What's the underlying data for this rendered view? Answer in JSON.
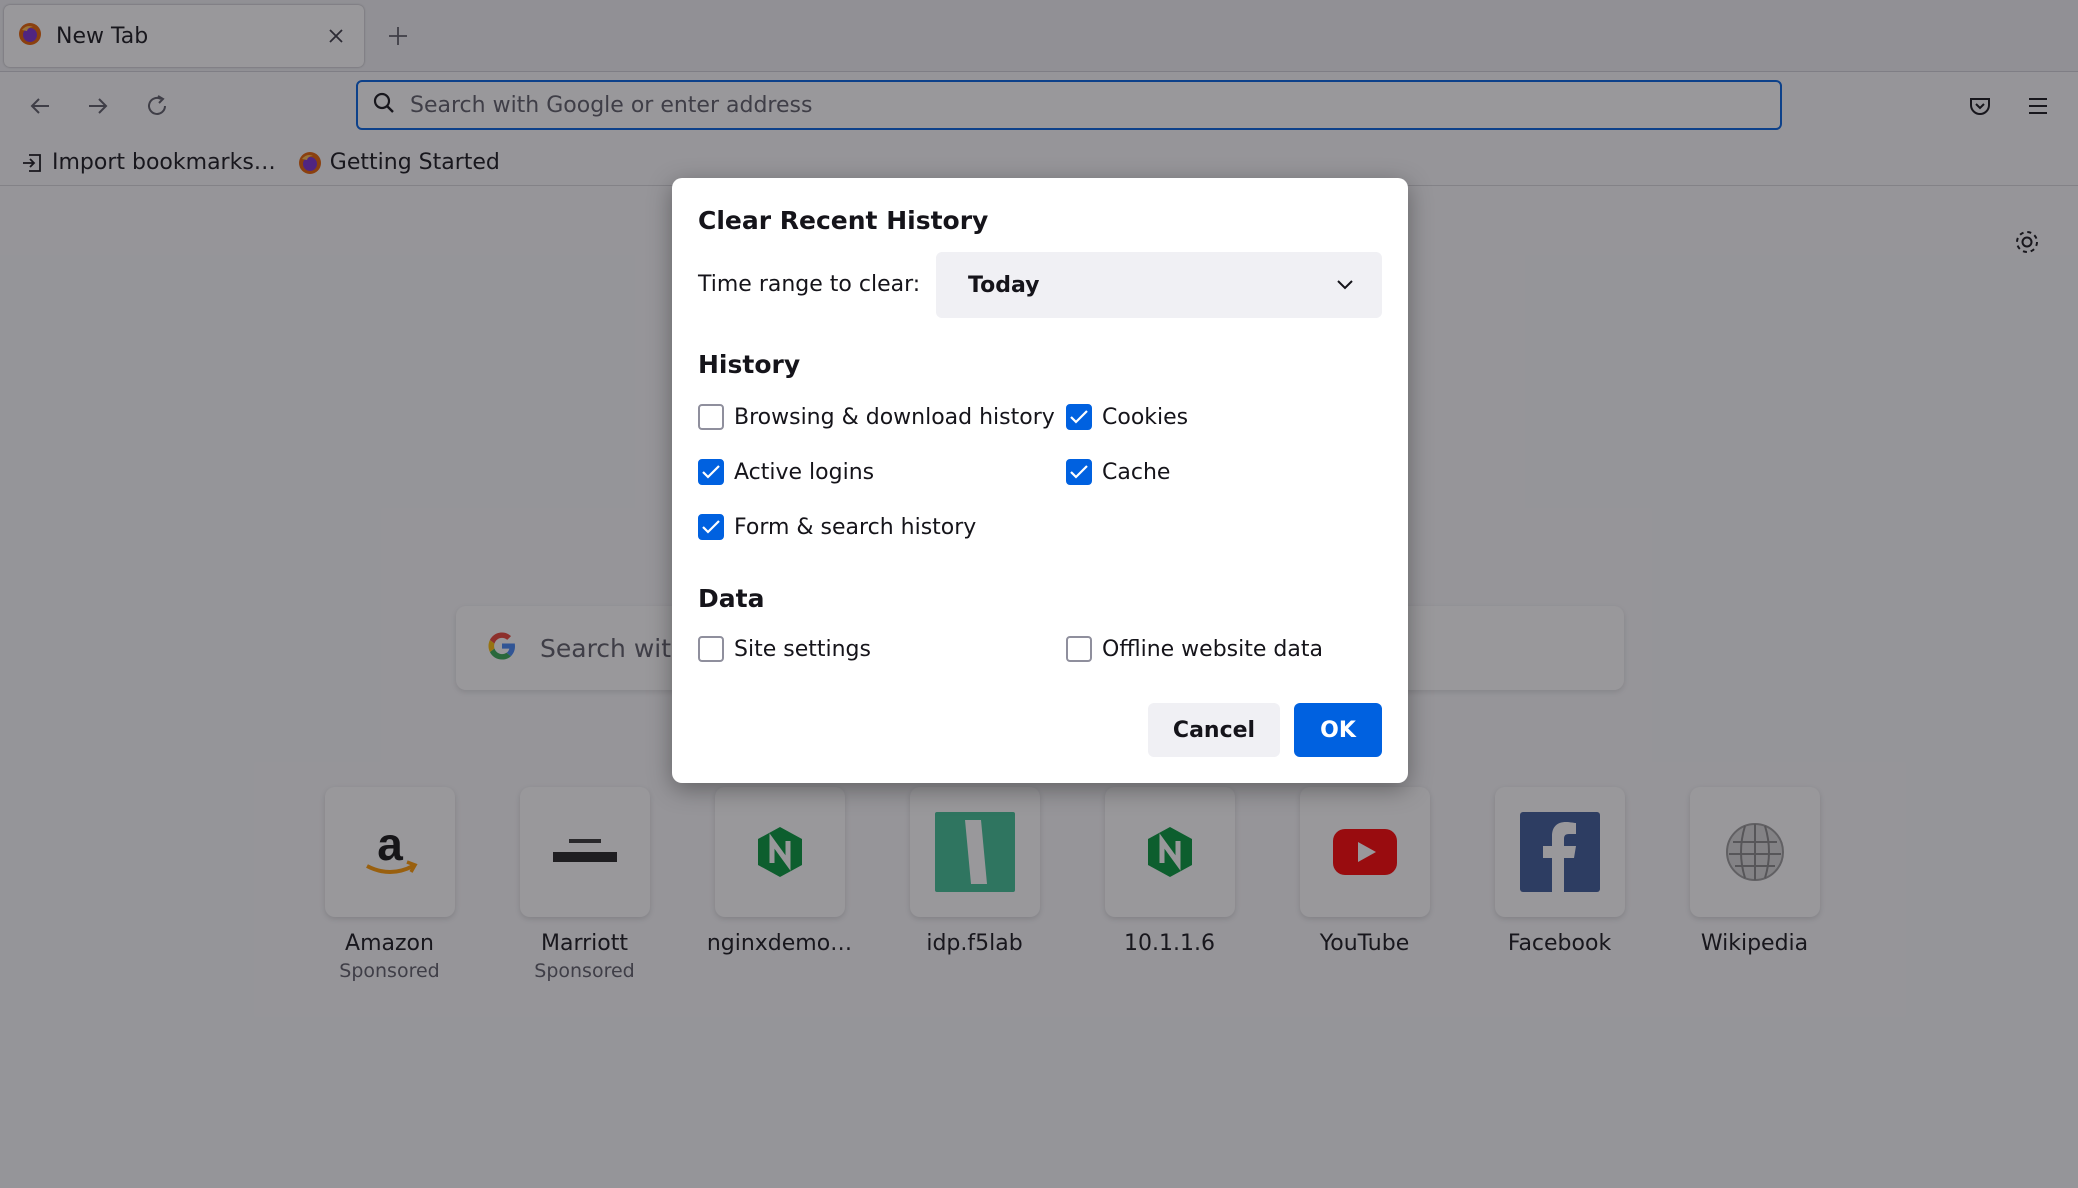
{
  "tab": {
    "title": "New Tab"
  },
  "urlbar": {
    "placeholder": "Search with Google or enter address"
  },
  "bookmarks": [
    {
      "label": "Import bookmarks…"
    },
    {
      "label": "Getting Started"
    }
  ],
  "search": {
    "placeholder": "Search with Google or enter address"
  },
  "tiles": [
    {
      "title": "Amazon",
      "sub": "Sponsored"
    },
    {
      "title": "Marriott",
      "sub": "Sponsored"
    },
    {
      "title": "nginxdemo…",
      "sub": ""
    },
    {
      "title": "idp.f5lab",
      "sub": ""
    },
    {
      "title": "10.1.1.6",
      "sub": ""
    },
    {
      "title": "YouTube",
      "sub": ""
    },
    {
      "title": "Facebook",
      "sub": ""
    },
    {
      "title": "Wikipedia",
      "sub": ""
    }
  ],
  "dialog": {
    "title": "Clear Recent History",
    "range_label": "Time range to clear:",
    "range_value": "Today",
    "history_heading": "History",
    "data_heading": "Data",
    "options": {
      "browsing": {
        "label": "Browsing & download history",
        "checked": false
      },
      "cookies": {
        "label": "Cookies",
        "checked": true
      },
      "logins": {
        "label": "Active logins",
        "checked": true
      },
      "cache": {
        "label": "Cache",
        "checked": true
      },
      "forms": {
        "label": "Form & search history",
        "checked": true
      },
      "site_settings": {
        "label": "Site settings",
        "checked": false
      },
      "offline": {
        "label": "Offline website data",
        "checked": false
      }
    },
    "cancel_label": "Cancel",
    "ok_label": "OK"
  },
  "colors": {
    "accent": "#0061e0",
    "overlay": "rgba(28,27,34,0.45)"
  }
}
